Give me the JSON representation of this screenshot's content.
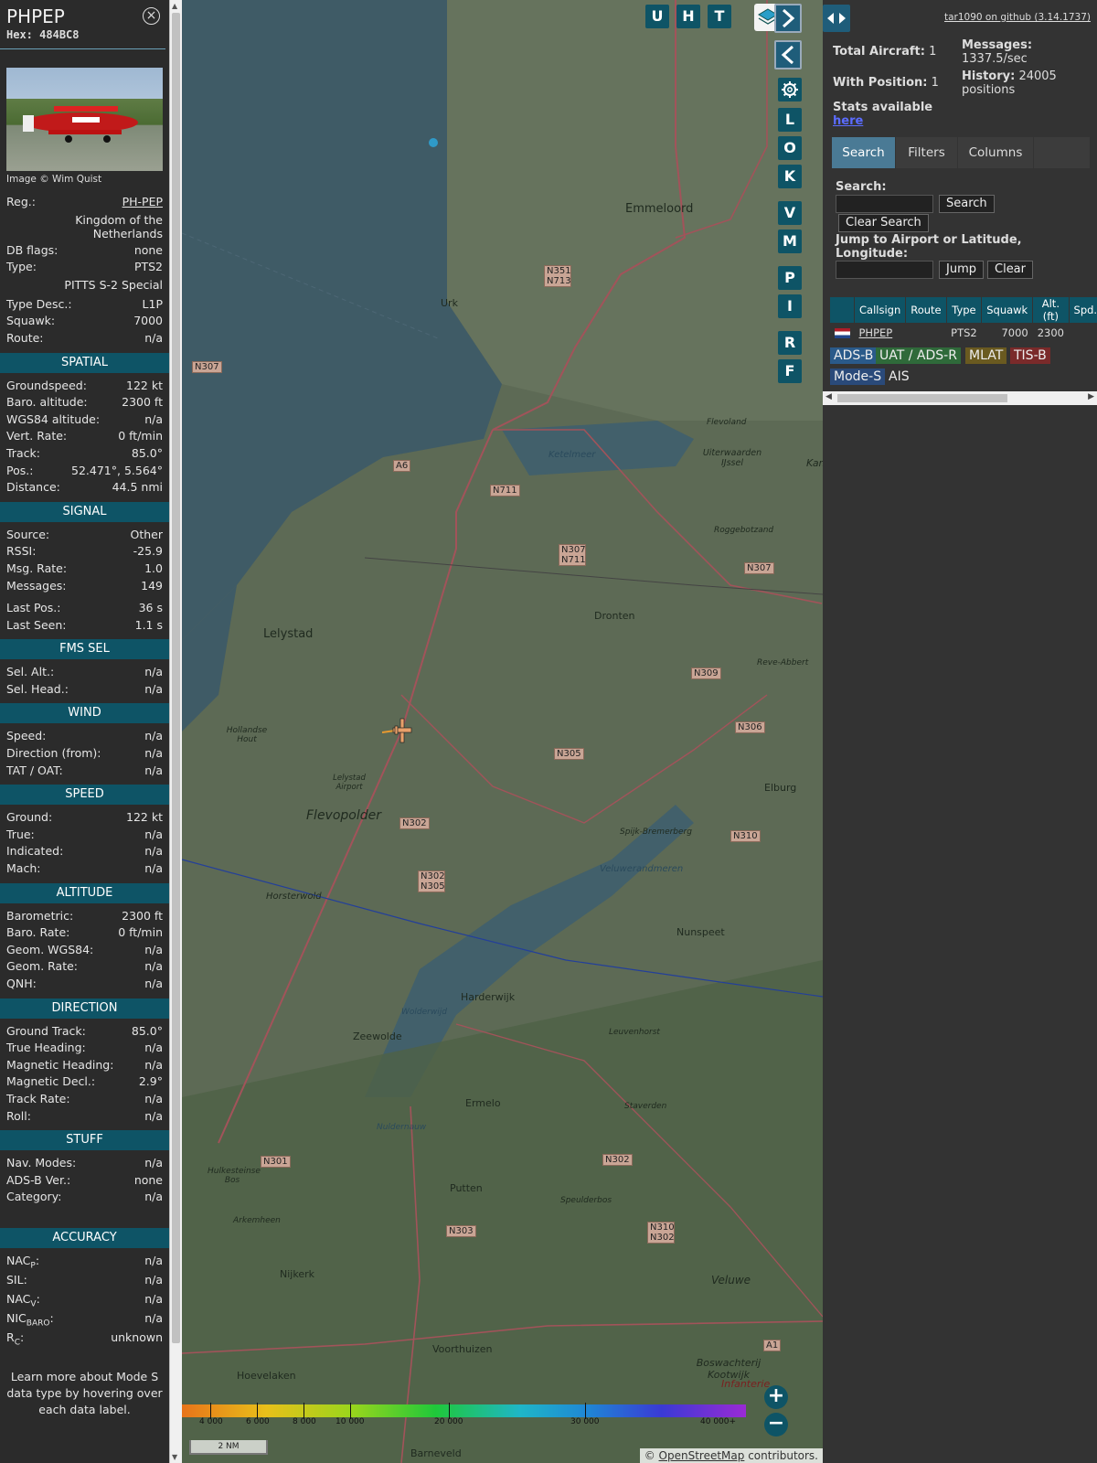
{
  "info": {
    "title": "PHPEP",
    "hex_label": "Hex:",
    "hex": "484BC8",
    "photo_credit": "Image © Wim Quist",
    "reg_label": "Reg.:",
    "reg": "PH-PEP",
    "country": "Kingdom of the Netherlands",
    "dbflags_label": "DB flags:",
    "dbflags": "none",
    "type_label": "Type:",
    "type": "PTS2",
    "type_name": "PITTS S-2 Special",
    "typedesc_label": "Type Desc.:",
    "typedesc": "L1P",
    "squawk_label": "Squawk:",
    "squawk": "7000",
    "route_label": "Route:",
    "route": "n/a",
    "sections": {
      "spatial": "SPATIAL",
      "signal": "SIGNAL",
      "fms": "FMS SEL",
      "wind": "WIND",
      "speed": "SPEED",
      "altitude": "ALTITUDE",
      "direction": "DIRECTION",
      "stuff": "STUFF",
      "accuracy": "ACCURACY"
    },
    "spatial": [
      {
        "label": "Groundspeed:",
        "value": "122 kt"
      },
      {
        "label": "Baro. altitude:",
        "value": "2300 ft"
      },
      {
        "label": "WGS84 altitude:",
        "value": "n/a"
      },
      {
        "label": "Vert. Rate:",
        "value": "0 ft/min"
      },
      {
        "label": "Track:",
        "value": "85.0°"
      },
      {
        "label": "Pos.:",
        "value": "52.471°, 5.564°"
      },
      {
        "label": "Distance:",
        "value": "44.5 nmi"
      }
    ],
    "signal": [
      {
        "label": "Source:",
        "value": "Other"
      },
      {
        "label": "RSSI:",
        "value": "-25.9"
      },
      {
        "label": "Msg. Rate:",
        "value": "1.0"
      },
      {
        "label": "Messages:",
        "value": "149"
      }
    ],
    "signal2": [
      {
        "label": "Last Pos.:",
        "value": "36 s"
      },
      {
        "label": "Last Seen:",
        "value": "1.1 s"
      }
    ],
    "fms": [
      {
        "label": "Sel. Alt.:",
        "value": "n/a"
      },
      {
        "label": "Sel. Head.:",
        "value": "n/a"
      }
    ],
    "wind": [
      {
        "label": "Speed:",
        "value": "n/a"
      },
      {
        "label": "Direction (from):",
        "value": "n/a"
      },
      {
        "label": "TAT / OAT:",
        "value": "n/a"
      }
    ],
    "speed": [
      {
        "label": "Ground:",
        "value": "122 kt"
      },
      {
        "label": "True:",
        "value": "n/a"
      },
      {
        "label": "Indicated:",
        "value": "n/a"
      },
      {
        "label": "Mach:",
        "value": "n/a"
      }
    ],
    "altitude": [
      {
        "label": "Barometric:",
        "value": "2300 ft"
      },
      {
        "label": "Baro. Rate:",
        "value": "0 ft/min"
      },
      {
        "label": "Geom. WGS84:",
        "value": "n/a"
      },
      {
        "label": "Geom. Rate:",
        "value": "n/a"
      },
      {
        "label": "QNH:",
        "value": "n/a"
      }
    ],
    "direction": [
      {
        "label": "Ground Track:",
        "value": "85.0°"
      },
      {
        "label": "True Heading:",
        "value": "n/a"
      },
      {
        "label": "Magnetic Heading:",
        "value": "n/a"
      },
      {
        "label": "Magnetic Decl.:",
        "value": "2.9°"
      },
      {
        "label": "Track Rate:",
        "value": "n/a"
      },
      {
        "label": "Roll:",
        "value": "n/a"
      }
    ],
    "stuff": [
      {
        "label": "Nav. Modes:",
        "value": "n/a"
      },
      {
        "label": "ADS-B Ver.:",
        "value": "none"
      },
      {
        "label": "Category:",
        "value": "n/a"
      }
    ],
    "accuracy": [
      {
        "label": "NAC",
        "sub": "P",
        "value": "n/a"
      },
      {
        "label": "SIL:",
        "sub": "",
        "value": "n/a"
      },
      {
        "label": "NAC",
        "sub": "V",
        "value": "n/a"
      },
      {
        "label": "NIC",
        "sub": "BARO",
        "value": "n/a"
      },
      {
        "label": "R",
        "sub": "C",
        "value": "unknown"
      }
    ],
    "footnote": "Learn more about Mode S data type by hovering over each data label."
  },
  "map": {
    "buttons_top": [
      "U",
      "H",
      "T"
    ],
    "nav_next": "›",
    "nav_prev": "‹",
    "side_buttons": [
      "L",
      "O",
      "K",
      "V",
      "M",
      "P",
      "I",
      "R",
      "F"
    ],
    "places": [
      "Emmeloord",
      "Urk",
      "Lelystad",
      "Dronten",
      "Flevopolder",
      "Elburg",
      "Nunspeet",
      "Harderwijk",
      "Zeewolde",
      "Ermelo",
      "Putten",
      "Nijkerk",
      "Voorthuizen",
      "Hoevelaken",
      "Barneveld",
      "Veluwe",
      "Ketelmeer",
      "Veluwerandmeren",
      "Horsterwold",
      "Lelystad Airport",
      "Uiterwaarden IJssel",
      "Roggebotzand",
      "Reve-Abbert",
      "Spijk-Bremerberg",
      "Leuvenhorst",
      "Staverden",
      "Speulderbos",
      "Wolderwijd",
      "Nuldernauw",
      "Hollandse Hout",
      "Arkemheen",
      "Hulkesteinse Bos",
      "Boswachterij Kootwijk",
      "Infanterie",
      "Flevoland",
      "Kam"
    ],
    "roads": [
      "N307",
      "A6",
      "N711",
      "N351 N713",
      "N307 N711",
      "N309",
      "N306",
      "N305",
      "N302",
      "N302 N305",
      "N310",
      "N301",
      "N303",
      "N310 N302",
      "A1"
    ],
    "alt_ticks": [
      "4 000",
      "6 000",
      "8 000",
      "10 000",
      "20 000",
      "30 000",
      "40 000+"
    ],
    "scale": "2 NM",
    "attribution_prefix": "©",
    "attribution_link": "OpenStreetMap",
    "attribution_suffix": "contributors.",
    "zoom_in": "+",
    "zoom_out": "−"
  },
  "right": {
    "github": "tar1090 on github (3.14.1737)",
    "total_aircraft_label": "Total Aircraft:",
    "total_aircraft": "1",
    "with_position_label": "With Position:",
    "with_position": "1",
    "messages_label": "Messages:",
    "messages": "1337.5/sec",
    "history_label": "History:",
    "history": "24005 positions",
    "stats_label": "Stats available",
    "stats_link": "here",
    "tabs": [
      "Search",
      "Filters",
      "Columns"
    ],
    "search_label": "Search:",
    "search_button": "Search",
    "clear_search": "Clear Search",
    "jump_label": "Jump to Airport or Latitude, Longitude:",
    "jump_button": "Jump",
    "clear_button": "Clear",
    "columns": [
      "",
      "Callsign",
      "Route",
      "Type",
      "Squawk",
      "Alt. (ft)",
      "Spd."
    ],
    "row": {
      "callsign": "PHPEP",
      "route": "",
      "type": "PTS2",
      "squawk": "7000",
      "alt": "2300",
      "spd": ""
    },
    "legend": [
      {
        "label": "ADS-B",
        "color": "#2a5a8a"
      },
      {
        "label": "UAT / ADS-R",
        "color": "#2f6a3a"
      },
      {
        "label": "MLAT",
        "color": "#6a5a20"
      },
      {
        "label": "TIS-B",
        "color": "#7a2a2a"
      },
      {
        "label": "Mode-S",
        "color": "#2a4a7a"
      },
      {
        "label": "AIS",
        "color": "#333333"
      }
    ]
  }
}
